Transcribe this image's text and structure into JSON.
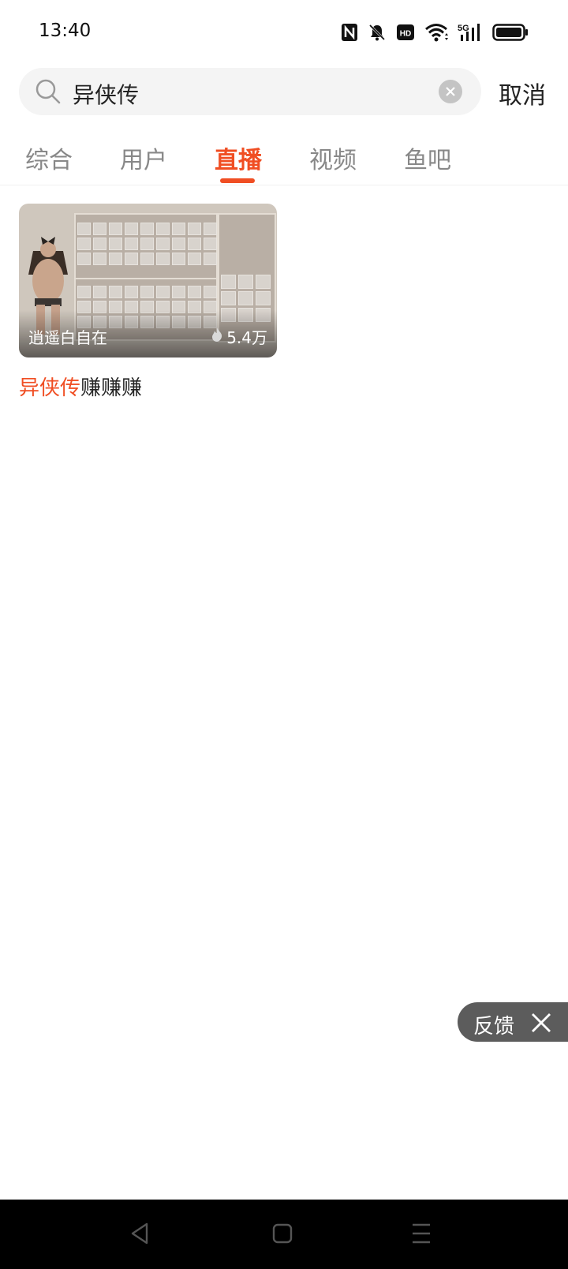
{
  "status_bar": {
    "time": "13:40",
    "icons": [
      "nfc-icon",
      "mute-icon",
      "hd-icon",
      "wifi-icon",
      "5g-signal-icon",
      "battery-icon"
    ],
    "hd_text": "HD",
    "network_text": "5G"
  },
  "search": {
    "query": "异侠传",
    "cancel_label": "取消"
  },
  "tabs": [
    {
      "label": "综合",
      "active": false
    },
    {
      "label": "用户",
      "active": false
    },
    {
      "label": "直播",
      "active": true
    },
    {
      "label": "视频",
      "active": false
    },
    {
      "label": "鱼吧",
      "active": false
    }
  ],
  "results": [
    {
      "streamer": "逍遥白自在",
      "viewers": "5.4万",
      "title_highlight": "异侠传",
      "title_rest": "赚赚赚"
    }
  ],
  "feedback": {
    "label": "反馈"
  },
  "colors": {
    "accent": "#f04e23",
    "search_bg": "#f4f4f4",
    "feedback_bg": "#5c5c5c",
    "nav_bar_bg": "#000000"
  }
}
